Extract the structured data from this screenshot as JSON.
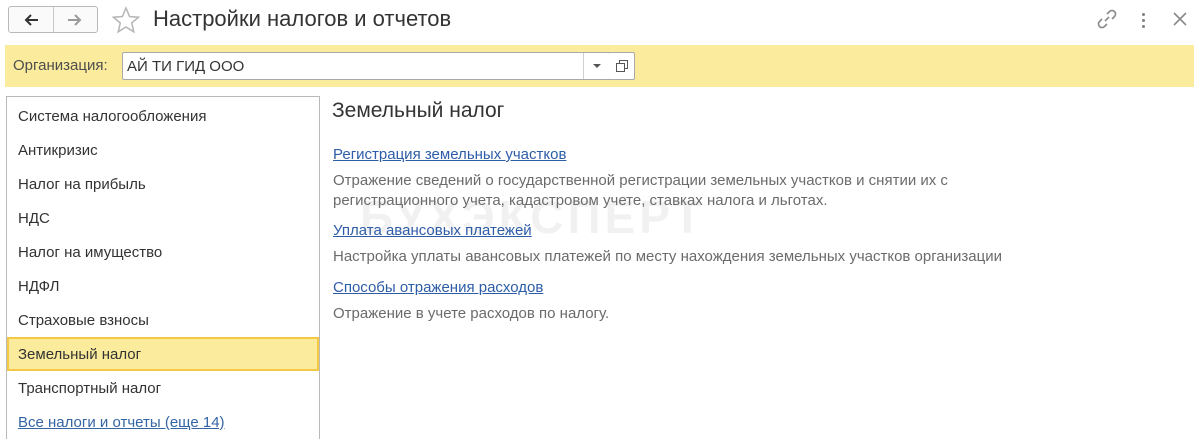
{
  "window": {
    "title": "Настройки налогов и отчетов"
  },
  "icons": {
    "back": "arrow-left-icon",
    "forward": "arrow-right-icon",
    "favorite": "star-icon",
    "link": "link-icon",
    "menu": "more-vertical-icon",
    "close": "close-icon",
    "dropdown": "chevron-down-icon",
    "open": "open-form-icon"
  },
  "colors": {
    "accent_bar": "#fbec9d",
    "active_border": "#f5c945",
    "link": "#2e5da8"
  },
  "organization": {
    "label": "Организация:",
    "value": "АЙ ТИ ГИД ООО"
  },
  "sidebar": {
    "items": [
      {
        "label": "Система налогообложения"
      },
      {
        "label": "Антикризис"
      },
      {
        "label": "Налог на прибыль"
      },
      {
        "label": "НДС"
      },
      {
        "label": "Налог на имущество"
      },
      {
        "label": "НДФЛ"
      },
      {
        "label": "Страховые взносы"
      },
      {
        "label": "Земельный налог",
        "active": true
      },
      {
        "label": "Транспортный налог"
      }
    ],
    "all_link": "Все налоги и отчеты (еще 14)"
  },
  "content": {
    "title": "Земельный налог",
    "sections": [
      {
        "link": "Регистрация земельных участков",
        "description_line1": "Отражение сведений о государственной регистрации земельных участков и снятии их с",
        "description_line2": "регистрационного учета, кадастровом учете, ставках налога и льготах."
      },
      {
        "link": "Уплата авансовых платежей",
        "description_line1": "Настройка уплаты авансовых платежей по месту нахождения земельных участков организации"
      },
      {
        "link": "Способы отражения расходов",
        "description_line1": "Отражение в учете расходов по налогу."
      }
    ]
  },
  "watermark": "БУХЭКСПЕРТ"
}
